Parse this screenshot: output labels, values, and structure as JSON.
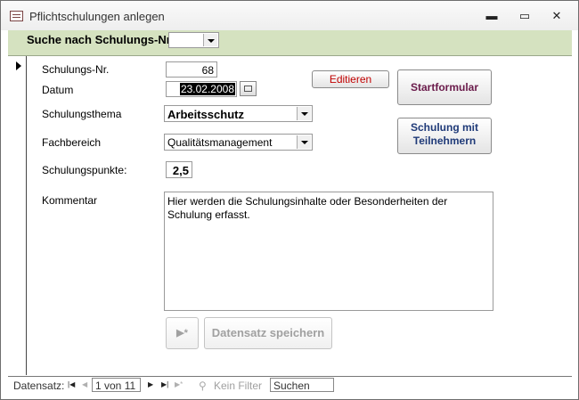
{
  "window": {
    "title": "Pflichtschulungen anlegen",
    "minimize_glyph": "▬",
    "restore_glyph": "▭",
    "close_glyph": "✕"
  },
  "header": {
    "search_label": "Suche nach Schulungs-Nr.",
    "search_value": ""
  },
  "form": {
    "schulungsnr_label": "Schulungs-Nr.",
    "schulungsnr_value": "68",
    "datum_label": "Datum",
    "datum_value": "23.02.2008",
    "thema_label": "Schulungsthema",
    "thema_value": "Arbeitsschutz",
    "fachbereich_label": "Fachbereich",
    "fachbereich_value": "Qualitätsmanagement",
    "punkte_label": "Schulungspunkte:",
    "punkte_value": "2,5",
    "kommentar_label": "Kommentar",
    "kommentar_value": "Hier werden die Schulungsinhalte oder Besonderheiten der Schulung erfasst."
  },
  "buttons": {
    "edit": "Editieren",
    "startformular": "Startformular",
    "schulung_line1": "Schulung mit",
    "schulung_line2": "Teilnehmern",
    "new_record": "▶*",
    "save": "Datensatz speichern"
  },
  "statusbar": {
    "label": "Datensatz:",
    "first": "|◀",
    "prev": "◀",
    "record_position": "1 von 11",
    "next": "▶",
    "last": "▶|",
    "new": "▶*",
    "filter": "Kein Filter",
    "search": "Suchen"
  },
  "colors": {
    "header_bg": "#d5e2c0",
    "edit_text": "#c00000",
    "startformular_text": "#6a1a4a",
    "schulung_text": "#1f3a78"
  }
}
